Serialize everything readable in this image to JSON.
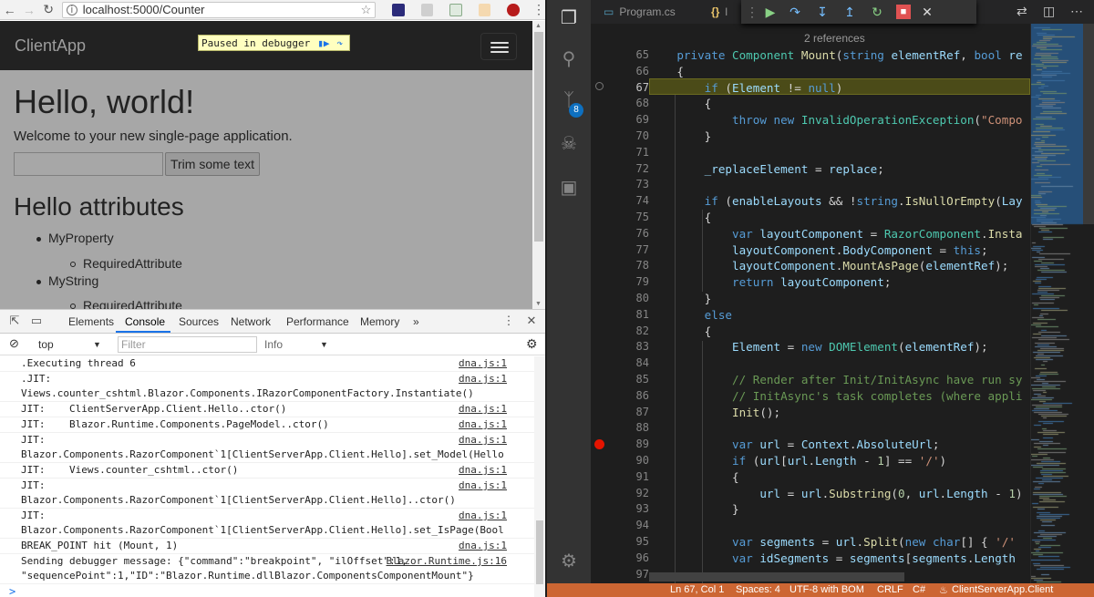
{
  "browser": {
    "url": "localhost:5000/Counter",
    "navbar": {
      "brand": "ClientApp"
    },
    "debugger_badge": {
      "text": "Paused in debugger"
    },
    "page": {
      "heading": "Hello, world!",
      "welcome": "Welcome to your new single-page application.",
      "trim_input_value": "",
      "trim_button": "Trim some text",
      "attributes_heading": "Hello attributes",
      "list": [
        {
          "label": "MyProperty",
          "children": [
            "RequiredAttribute"
          ]
        },
        {
          "label": "MyString",
          "children": [
            "RequiredAttribute"
          ]
        }
      ]
    },
    "devtools": {
      "tabs": [
        "Elements",
        "Console",
        "Sources",
        "Network",
        "Performance",
        "Memory"
      ],
      "active_tab": "Console",
      "more": "»",
      "context": "top",
      "filter_placeholder": "Filter",
      "level": "Info",
      "console": [
        {
          "text": ".Executing thread 6",
          "source": "dna.js:1"
        },
        {
          "text": ".JIT:\nViews.counter_cshtml.Blazor.Components.IRazorComponentFactory.Instantiate()",
          "source": "dna.js:1"
        },
        {
          "text": "JIT:    ClientServerApp.Client.Hello..ctor()",
          "source": "dna.js:1"
        },
        {
          "text": "JIT:    Blazor.Runtime.Components.PageModel..ctor()",
          "source": "dna.js:1"
        },
        {
          "text": "JIT:\nBlazor.Components.RazorComponent`1[ClientServerApp.Client.Hello].set_Model(Hello)",
          "source": "dna.js:1"
        },
        {
          "text": "JIT:    Views.counter_cshtml..ctor()",
          "source": "dna.js:1"
        },
        {
          "text": "JIT:\nBlazor.Components.RazorComponent`1[ClientServerApp.Client.Hello]..ctor()",
          "source": "dna.js:1"
        },
        {
          "text": "JIT:\nBlazor.Components.RazorComponent`1[ClientServerApp.Client.Hello].set_IsPage(Boolean)",
          "source": "dna.js:1"
        },
        {
          "text": "BREAK_POINT hit (Mount, 1)",
          "source": "dna.js:1"
        },
        {
          "text": "Sending debugger message: {\"command\":\"breakpoint\", \"ilOffset\":1,\n\"sequencePoint\":1,\"ID\":\"Blazor.Runtime.dllBlazor.ComponentsComponentMount\"}",
          "source": "Blazor.Runtime.js:16"
        }
      ],
      "prompt": ">"
    }
  },
  "vscode": {
    "tabs": [
      {
        "label": "Program.cs",
        "icon": "csharp-file-icon"
      },
      {
        "label": "l",
        "icon": "json-braces-icon"
      }
    ],
    "debug_toolbar": [
      "continue",
      "step-over",
      "step-into",
      "step-out",
      "restart",
      "stop"
    ],
    "editor": {
      "codelens": "2 references",
      "current_line": 67,
      "breakpoint_line": 89,
      "lines": [
        {
          "n": 65,
          "html": "    <span class='kw'>private</span> <span class='ty'>Component</span> <span class='fn'>Mount</span>(<span class='kw'>string</span> <span class='vr'>elementRef</span>, <span class='kw'>bool</span> <span class='vr'>re</span>"
        },
        {
          "n": 66,
          "html": "    {"
        },
        {
          "n": 67,
          "html": "        <span class='kw'>if</span> (<span class='vr'>Element</span> != <span class='kw'>null</span>)"
        },
        {
          "n": 68,
          "html": "        {"
        },
        {
          "n": 69,
          "html": "            <span class='kw'>throw</span> <span class='kw'>new</span> <span class='ty'>InvalidOperationException</span>(<span class='st'>\"Compo</span>"
        },
        {
          "n": 70,
          "html": "        }"
        },
        {
          "n": 71,
          "html": ""
        },
        {
          "n": 72,
          "html": "        <span class='vr'>_replaceElement</span> = <span class='vr'>replace</span>;"
        },
        {
          "n": 73,
          "html": ""
        },
        {
          "n": 74,
          "html": "        <span class='kw'>if</span> (<span class='vr'>enableLayouts</span> &amp;&amp; !<span class='kw'>string</span>.<span class='fn'>IsNullOrEmpty</span>(<span class='vr'>Lay</span>"
        },
        {
          "n": 75,
          "html": "        {"
        },
        {
          "n": 76,
          "html": "            <span class='kw'>var</span> <span class='vr'>layoutComponent</span> = <span class='ty'>RazorComponent</span>.<span class='fn'>Insta</span>"
        },
        {
          "n": 77,
          "html": "            <span class='vr'>layoutComponent</span>.<span class='vr'>BodyComponent</span> = <span class='kw'>this</span>;"
        },
        {
          "n": 78,
          "html": "            <span class='vr'>layoutComponent</span>.<span class='fn'>MountAsPage</span>(<span class='vr'>elementRef</span>);"
        },
        {
          "n": 79,
          "html": "            <span class='kw'>return</span> <span class='vr'>layoutComponent</span>;"
        },
        {
          "n": 80,
          "html": "        }"
        },
        {
          "n": 81,
          "html": "        <span class='kw'>else</span>"
        },
        {
          "n": 82,
          "html": "        {"
        },
        {
          "n": 83,
          "html": "            <span class='vr'>Element</span> = <span class='kw'>new</span> <span class='ty'>DOMElement</span>(<span class='vr'>elementRef</span>);"
        },
        {
          "n": 84,
          "html": ""
        },
        {
          "n": 85,
          "html": "            <span class='cm'>// Render after Init/InitAsync have run sy</span>"
        },
        {
          "n": 86,
          "html": "            <span class='cm'>// InitAsync's task completes (where appli</span>"
        },
        {
          "n": 87,
          "html": "            <span class='fn'>Init</span>();"
        },
        {
          "n": 88,
          "html": ""
        },
        {
          "n": 89,
          "html": "            <span class='kw'>var</span> <span class='vr'>url</span> = <span class='vr'>Context</span>.<span class='vr'>AbsoluteUrl</span>;"
        },
        {
          "n": 90,
          "html": "            <span class='kw'>if</span> (<span class='vr'>url</span>[<span class='vr'>url</span>.<span class='vr'>Length</span> - <span class='nm'>1</span>] == <span class='st'>'/'</span>)"
        },
        {
          "n": 91,
          "html": "            {"
        },
        {
          "n": 92,
          "html": "                <span class='vr'>url</span> = <span class='vr'>url</span>.<span class='fn'>Substring</span>(<span class='nm'>0</span>, <span class='vr'>url</span>.<span class='vr'>Length</span> - <span class='nm'>1</span>)"
        },
        {
          "n": 93,
          "html": "            }"
        },
        {
          "n": 94,
          "html": ""
        },
        {
          "n": 95,
          "html": "            <span class='kw'>var</span> <span class='vr'>segments</span> = <span class='vr'>url</span>.<span class='fn'>Split</span>(<span class='kw'>new</span> <span class='kw'>char</span>[] { <span class='st'>'/'</span>"
        },
        {
          "n": 96,
          "html": "            <span class='kw'>var</span> <span class='vr'>idSegments</span> = <span class='vr'>segments</span>[<span class='vr'>segments</span>.<span class='vr'>Length</span>"
        },
        {
          "n": 97,
          "html": ""
        }
      ]
    },
    "statusbar": {
      "position": "Ln 67, Col 1",
      "spaces": "Spaces: 4",
      "encoding": "UTF-8 with BOM",
      "eol": "CRLF",
      "language": "C#",
      "project": "ClientServerApp.Client"
    },
    "colors": {
      "status_debug": "#cc6633",
      "current_line": "#4b4b18",
      "breakpoint": "#e51400"
    }
  }
}
